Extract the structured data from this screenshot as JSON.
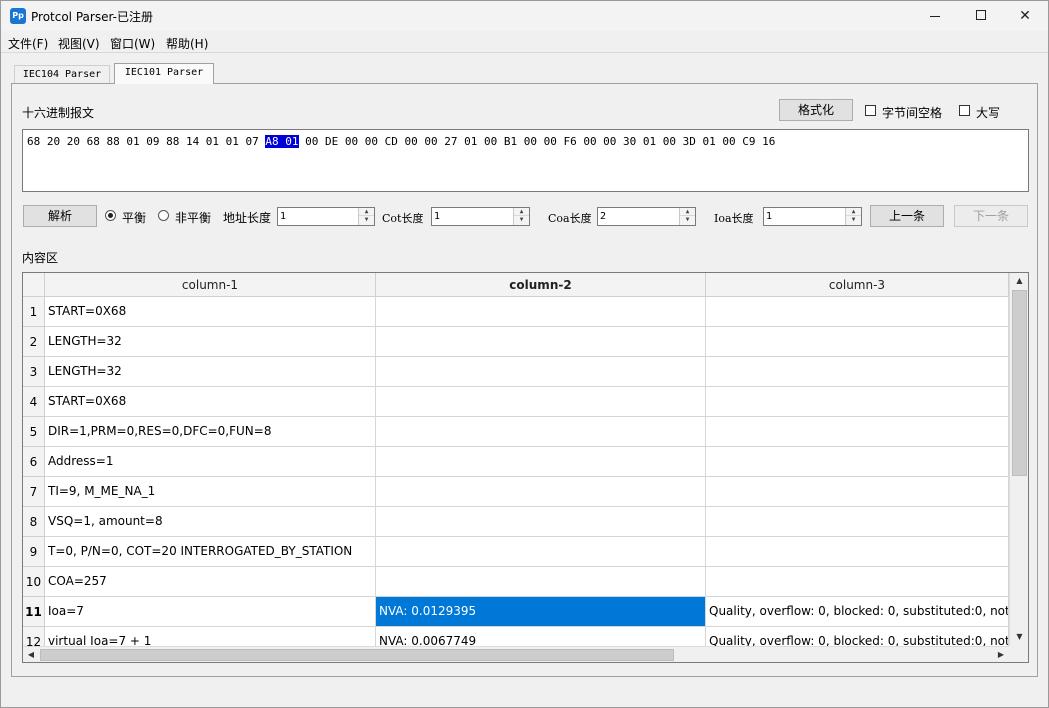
{
  "window": {
    "title": "Protcol Parser-已注册",
    "icon_text": "Pp",
    "minimize": "─",
    "maximize": "□",
    "close": "✕"
  },
  "menu": [
    "文件(F)",
    "视图(V)",
    "窗口(W)",
    "帮助(H)"
  ],
  "tabs": [
    {
      "label": "IEC104 Parser",
      "active": false
    },
    {
      "label": "IEC101 Parser",
      "active": true
    }
  ],
  "hex_section": {
    "label": "十六进制报文",
    "format_button": "格式化",
    "byte_space_label": "字节间空格",
    "uppercase_label": "大写",
    "hex_before": "68 20 20 68 88 01 09 88 14 01 01 07 ",
    "hex_selected": "A8 01",
    "hex_after": " 00 DE 00 00 CD 00 00 27 01 00 B1 00 00 F6 00 00 30 01 00 3D 01 00 C9 16"
  },
  "controls": {
    "parse_button": "解析",
    "balanced_label": "平衡",
    "unbalanced_label": "非平衡",
    "balanced_checked": true,
    "addr_len_label": "地址长度",
    "addr_len_value": "1",
    "cot_len_label": "Cot长度",
    "cot_len_value": "1",
    "coa_len_label": "Coa长度",
    "coa_len_value": "2",
    "ioa_len_label": "Ioa长度",
    "ioa_len_value": "1",
    "prev_button": "上一条",
    "next_button": "下一条"
  },
  "content": {
    "label": "内容区",
    "columns": [
      "column-1",
      "column-2",
      "column-3"
    ],
    "rows": [
      {
        "num": "1",
        "c1": "START=0X68",
        "c2": "",
        "c3": ""
      },
      {
        "num": "2",
        "c1": "LENGTH=32",
        "c2": "",
        "c3": ""
      },
      {
        "num": "3",
        "c1": "LENGTH=32",
        "c2": "",
        "c3": ""
      },
      {
        "num": "4",
        "c1": "START=0X68",
        "c2": "",
        "c3": ""
      },
      {
        "num": "5",
        "c1": "DIR=1,PRM=0,RES=0,DFC=0,FUN=8",
        "c2": "",
        "c3": ""
      },
      {
        "num": "6",
        "c1": "Address=1",
        "c2": "",
        "c3": ""
      },
      {
        "num": "7",
        "c1": "TI=9, M_ME_NA_1",
        "c2": "",
        "c3": ""
      },
      {
        "num": "8",
        "c1": "VSQ=1, amount=8",
        "c2": "",
        "c3": ""
      },
      {
        "num": "9",
        "c1": "T=0, P/N=0, COT=20 INTERROGATED_BY_STATION",
        "c2": "",
        "c3": ""
      },
      {
        "num": "10",
        "c1": "COA=257",
        "c2": "",
        "c3": ""
      },
      {
        "num": "11",
        "c1": "Ioa=7",
        "c2": "NVA: 0.0129395",
        "c3": "Quality, overflow: 0, blocked: 0, substituted:0, not ..."
      },
      {
        "num": "12",
        "c1": "virtual Ioa=7 + 1",
        "c2": "NVA: 0.0067749",
        "c3": "Quality, overflow: 0, blocked: 0, substituted:0, not ..."
      }
    ]
  }
}
